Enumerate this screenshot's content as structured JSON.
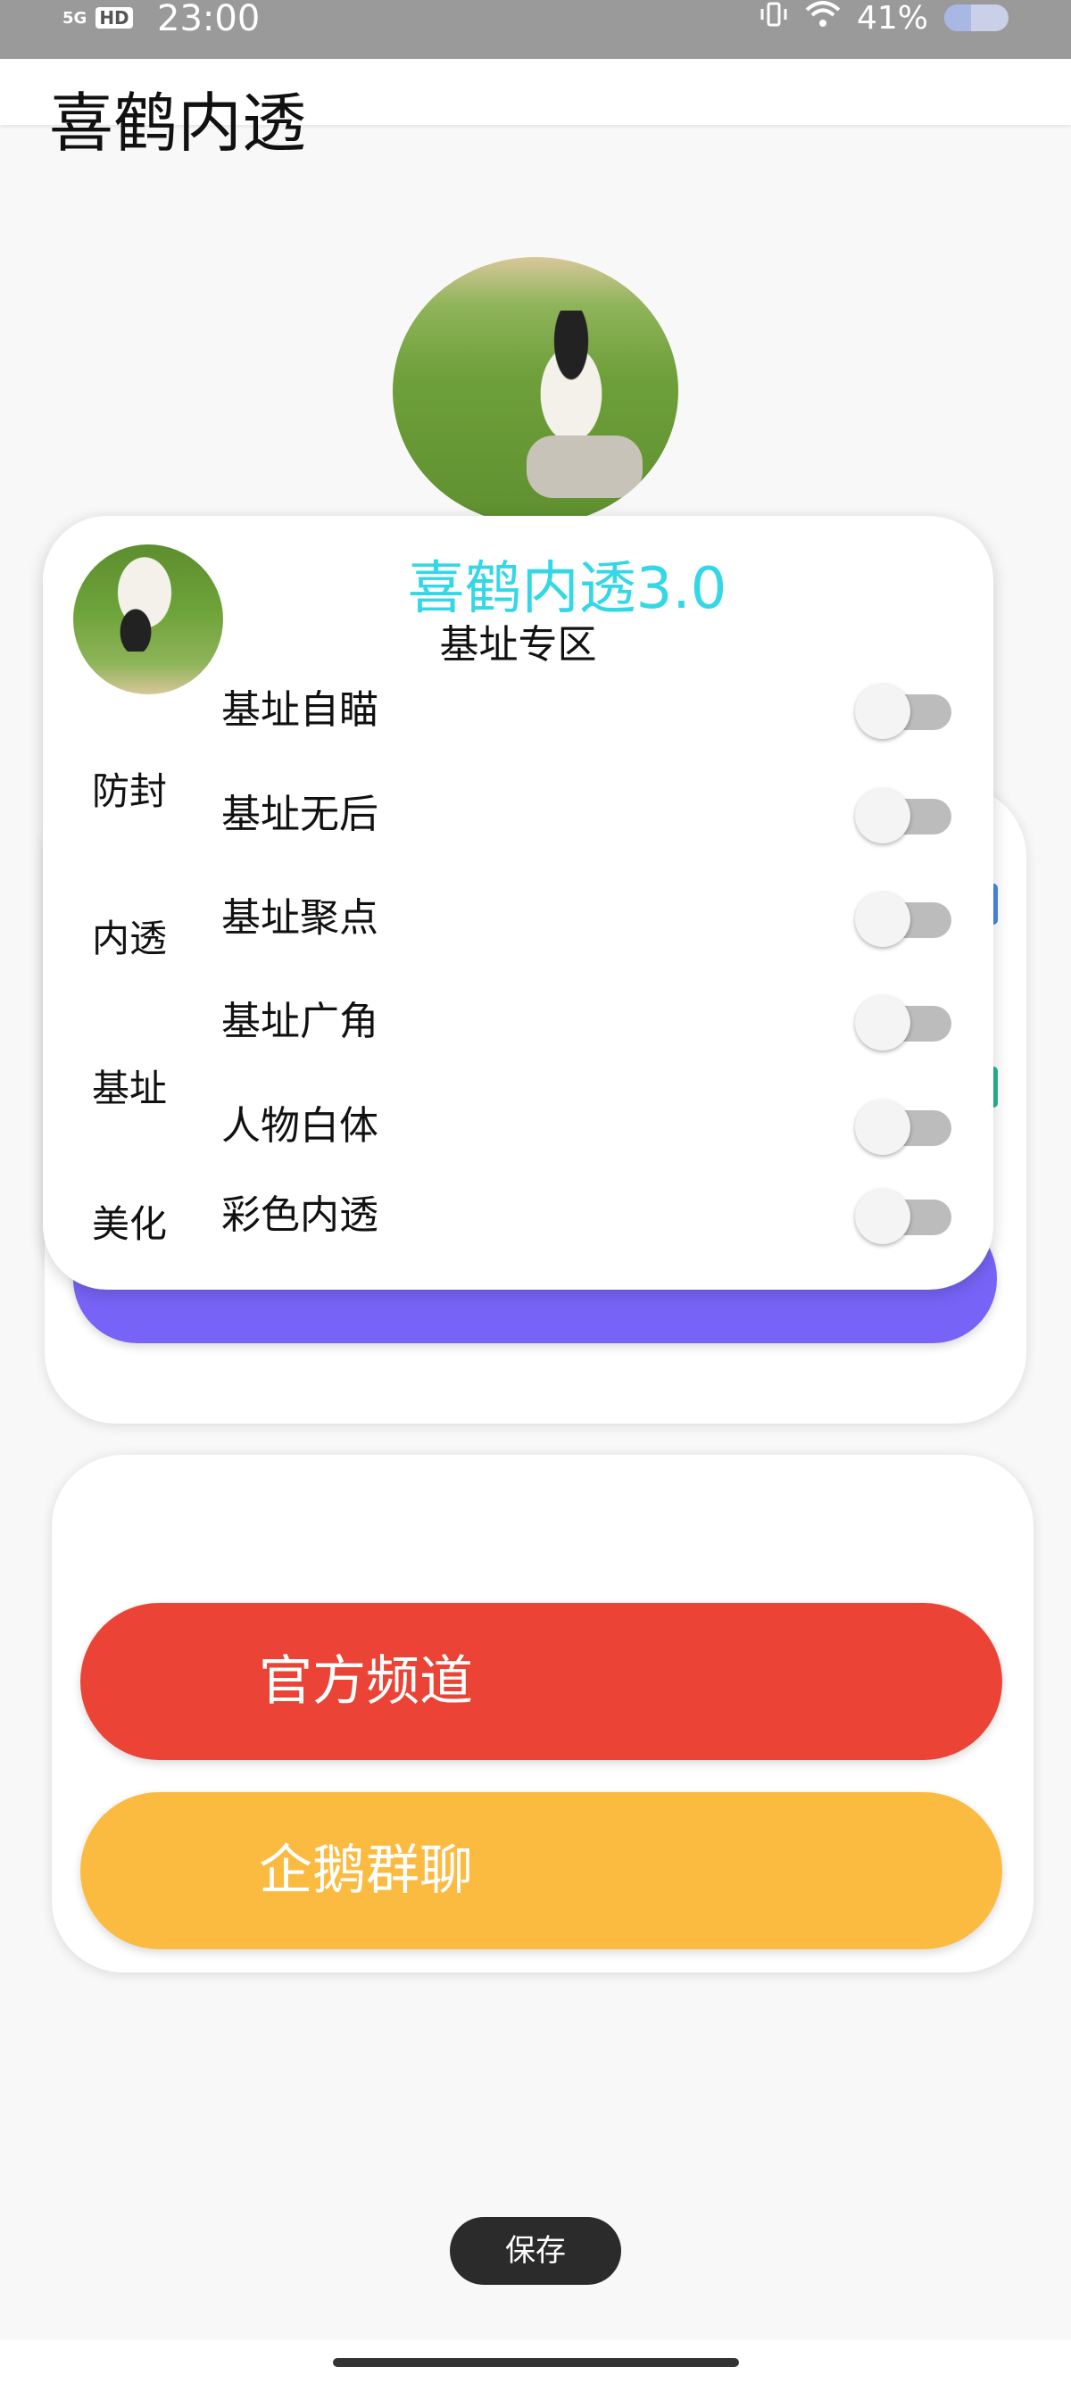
{
  "status_bar": {
    "signal": "5G",
    "hd": "HD",
    "time": "23:00",
    "battery_percent": "41%",
    "battery_level": 0.41
  },
  "app_bar": {
    "title": "喜鹤内透"
  },
  "menu": {
    "title": "喜鹤内透3.0",
    "subtitle": "基址专区",
    "categories": [
      "防封",
      "内透",
      "基址",
      "美化"
    ],
    "options": [
      {
        "label": "基址自瞄",
        "enabled": false
      },
      {
        "label": "基址无后",
        "enabled": false
      },
      {
        "label": "基址聚点",
        "enabled": false
      },
      {
        "label": "基址广角",
        "enabled": false
      },
      {
        "label": "人物白体",
        "enabled": false
      },
      {
        "label": "彩色内透",
        "enabled": false
      }
    ]
  },
  "links": {
    "official_channel": "官方频道",
    "qq_group": "企鹅群聊"
  },
  "toast": "保存",
  "colors": {
    "accent_title": "#34d7e6",
    "purple_button": "#7763f6",
    "red_button": "#eb4335",
    "yellow_button": "#fbbb41"
  }
}
